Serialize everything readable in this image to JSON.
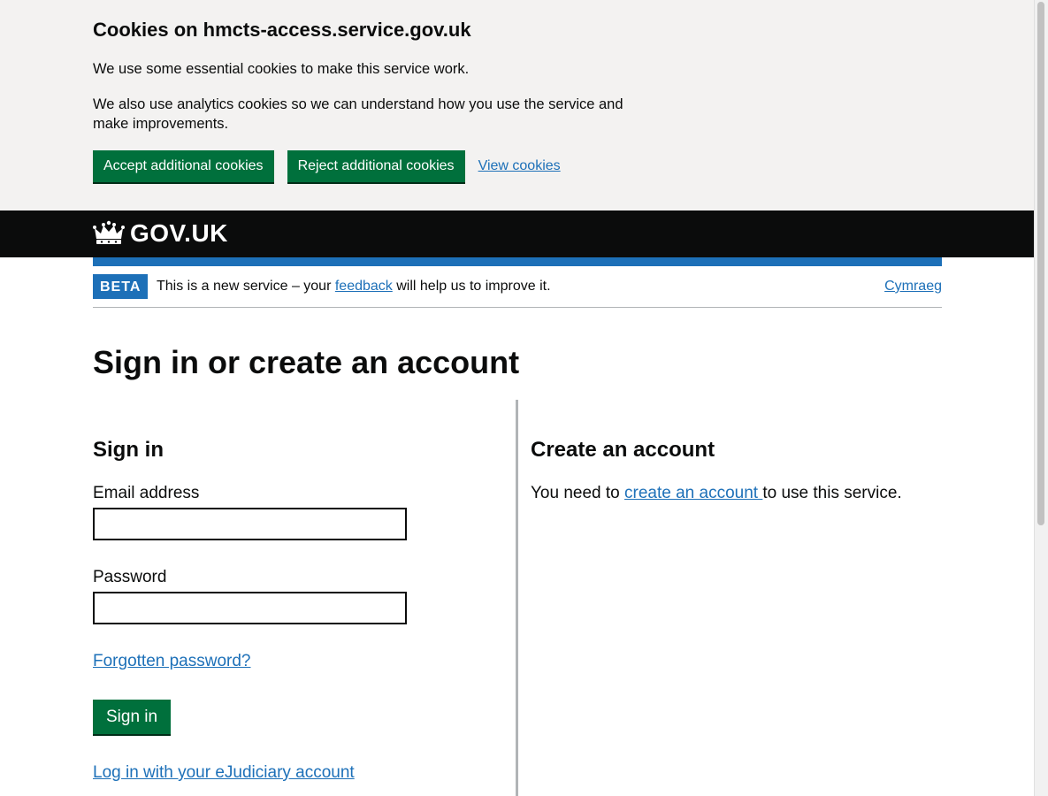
{
  "cookie_banner": {
    "title": "Cookies on hmcts-access.service.gov.uk",
    "paragraph_1": "We use some essential cookies to make this service work.",
    "paragraph_2": "We also use analytics cookies so we can understand how you use the service and make improvements.",
    "accept_label": "Accept additional cookies",
    "reject_label": "Reject additional cookies",
    "view_label": "View cookies"
  },
  "header": {
    "logo_text": "GOV.UK",
    "logo_icon": "crown-icon"
  },
  "phase_banner": {
    "tag": "BETA",
    "text_before": "This is a new service – your ",
    "feedback_link": "feedback",
    "text_after": " will help us to improve it.",
    "language_link": "Cymraeg"
  },
  "main": {
    "title": "Sign in or create an account",
    "sign_in": {
      "heading": "Sign in",
      "email_label": "Email address",
      "email_value": "",
      "password_label": "Password",
      "password_value": "",
      "forgot_link": "Forgotten password?",
      "submit_label": "Sign in",
      "ejudiciary_link": "Log in with your eJudiciary account"
    },
    "create_account": {
      "heading": "Create an account",
      "text_before": "You need to ",
      "link": "create an account ",
      "text_after": "to use this service."
    }
  },
  "colors": {
    "green": "#00703c",
    "link": "#1d70b8",
    "header_bg": "#0b0c0c",
    "cookie_bg": "#f3f2f1"
  }
}
